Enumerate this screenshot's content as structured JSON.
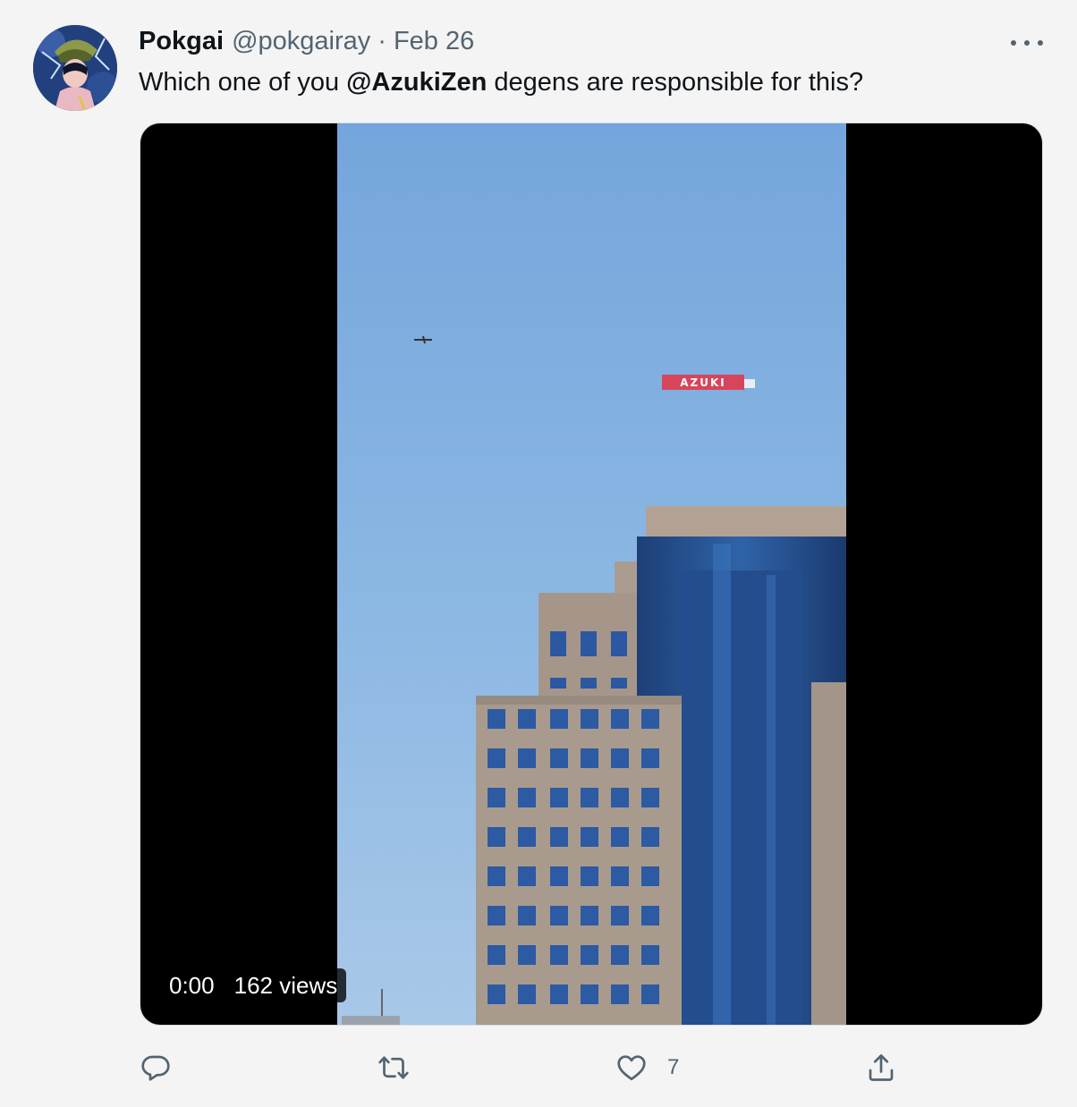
{
  "tweet": {
    "author_name": "Pokgai",
    "author_handle": "@pokgairay",
    "separator": "·",
    "date": "Feb 26",
    "text_before": "Which one of you ",
    "mention": "@AzukiZen",
    "text_after": " degens are responsible for this?"
  },
  "media": {
    "timestamp": "0:00",
    "views": "162 views",
    "banner_text": "AZUKI"
  },
  "actions": {
    "reply_icon": "reply-icon",
    "retweet_icon": "retweet-icon",
    "like_icon": "heart-icon",
    "like_count": "7",
    "share_icon": "share-icon"
  },
  "colors": {
    "background": "#f4f4f4",
    "text": "#0f1419",
    "muted": "#536471",
    "sky": "#79a9dc"
  }
}
